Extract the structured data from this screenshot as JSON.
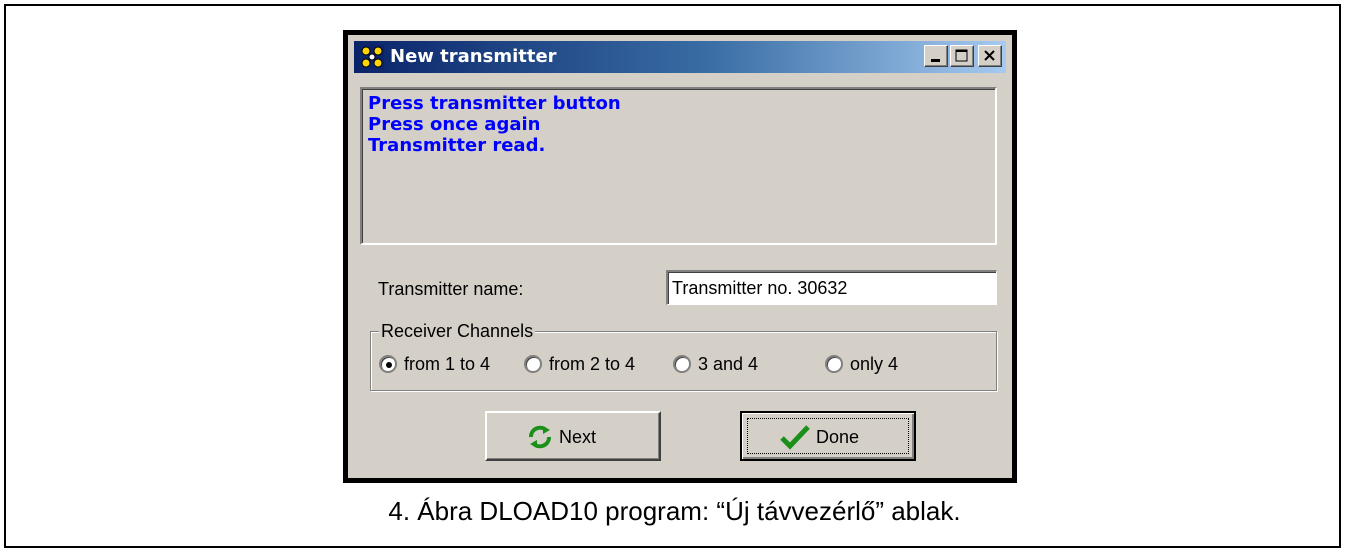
{
  "window": {
    "title": "New transmitter",
    "controls": {
      "minimize": "minimize-icon",
      "maximize": "maximize-icon",
      "close": "close-icon"
    }
  },
  "messages": [
    "Press transmitter button",
    "Press once again",
    "Transmitter read."
  ],
  "form": {
    "name_label": "Transmitter name:",
    "name_value": "Transmitter no. 30632",
    "channels_legend": "Receiver Channels",
    "channels": [
      {
        "label": "from 1 to 4",
        "selected": true
      },
      {
        "label": "from 2 to 4",
        "selected": false
      },
      {
        "label": "3 and 4",
        "selected": false
      },
      {
        "label": "only 4",
        "selected": false
      }
    ]
  },
  "buttons": {
    "next": "Next",
    "done": "Done"
  },
  "caption": "4. Ábra DLOAD10 program: “Új távvezérlő” ablak.",
  "colors": {
    "title_bar_start": "#0a246a",
    "title_bar_end": "#a6caf0",
    "message_text": "#0000ff",
    "window_face": "#d4d0c8"
  }
}
